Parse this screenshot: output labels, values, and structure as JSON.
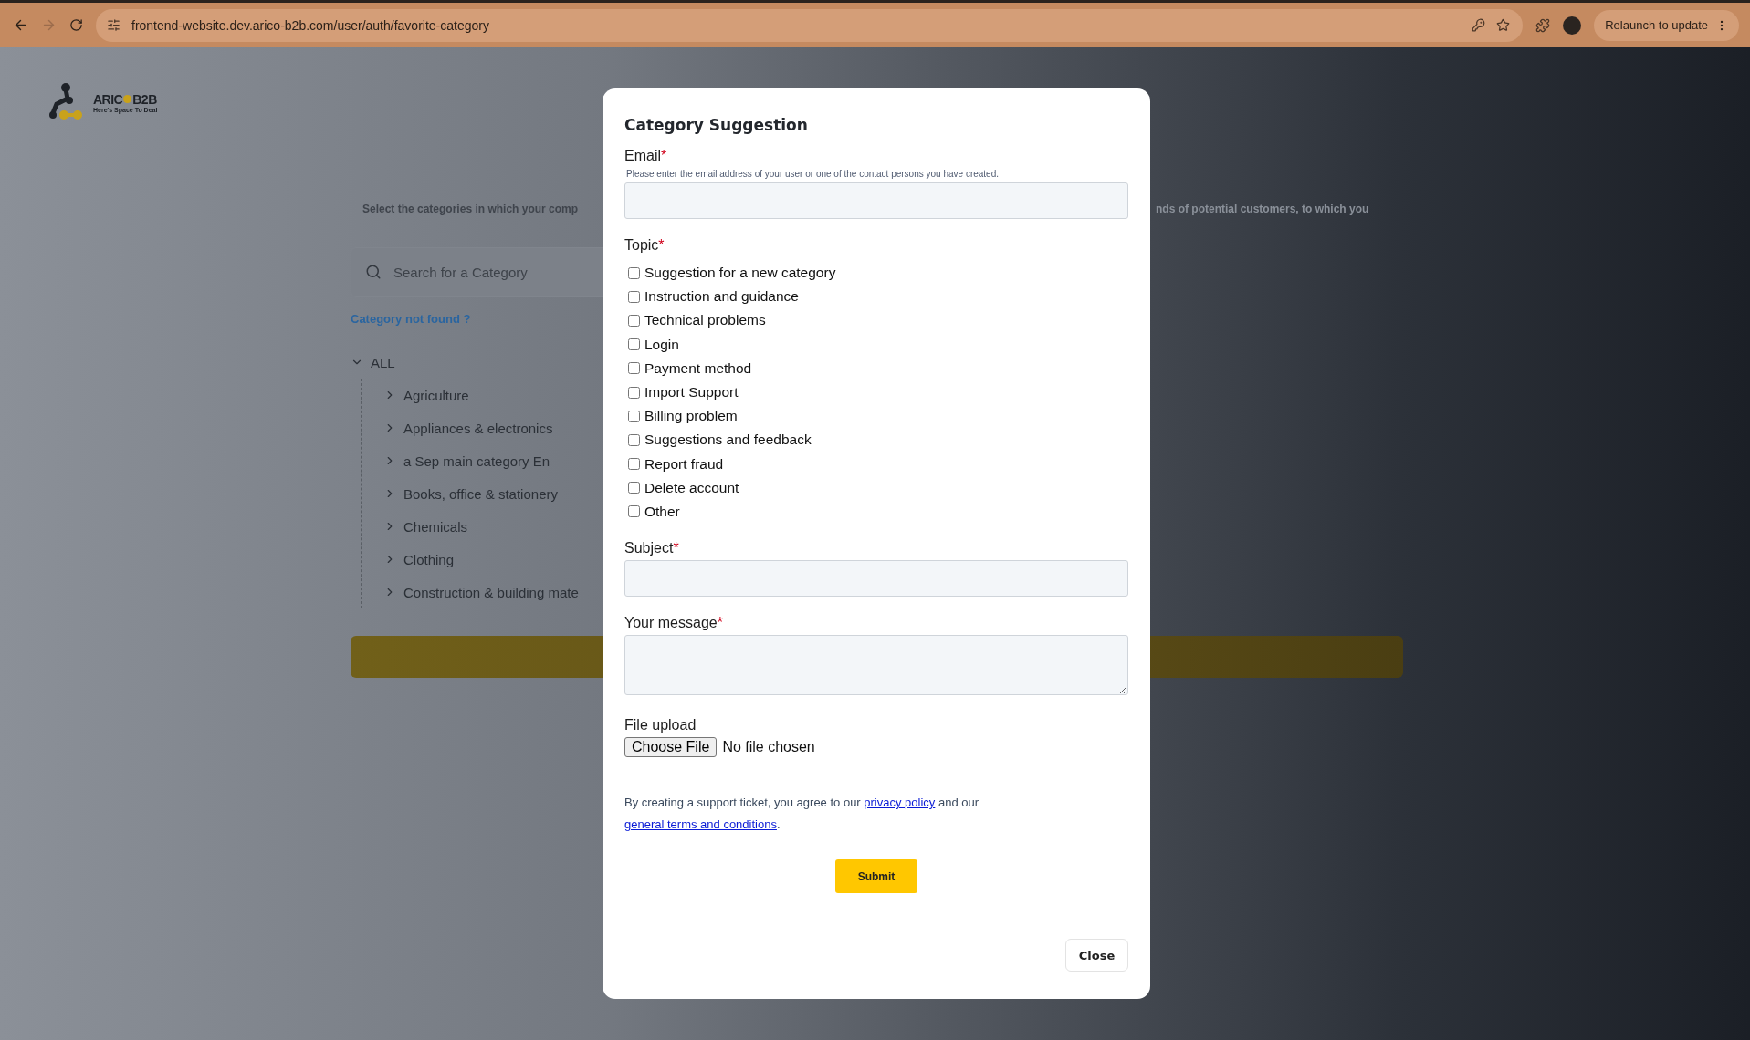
{
  "browser": {
    "nav": {
      "back_disabled": false,
      "forward_disabled": true
    },
    "url": "frontend-website.dev.arico-b2b.com/user/auth/favorite-category",
    "relaunch_label": "Relaunch to update"
  },
  "logo": {
    "name_start": "ARIC",
    "name_end": "B2B",
    "tagline": "Here's Space To Deal"
  },
  "page": {
    "intro_left": "Select the categories in which your comp",
    "intro_right": "nds of potential customers, to which you",
    "search": {
      "placeholder": "Search for a Category"
    },
    "not_found_link": "Category not found ?",
    "tree": {
      "label": "ALL",
      "expanded": true,
      "children": [
        {
          "label": "Agriculture",
          "expanded": false
        },
        {
          "label": "Appliances & electronics",
          "expanded": false
        },
        {
          "label": "a Sep main category En",
          "expanded": false
        },
        {
          "label": "Books, office & stationery",
          "expanded": false
        },
        {
          "label": "Chemicals",
          "expanded": false
        },
        {
          "label": "Clothing",
          "expanded": false
        },
        {
          "label": "Construction & building mate",
          "expanded": false
        }
      ]
    }
  },
  "modal": {
    "title": "Category Suggestion",
    "email": {
      "label": "Email",
      "required_mark": "*",
      "help": "Please enter the email address of your user or one of the contact persons you have created."
    },
    "topic": {
      "label": "Topic",
      "required_mark": "*",
      "options": [
        {
          "label": "Suggestion for a new category",
          "checked": false
        },
        {
          "label": "Instruction and guidance",
          "checked": false
        },
        {
          "label": "Technical problems",
          "checked": false
        },
        {
          "label": "Login",
          "checked": false
        },
        {
          "label": "Payment method",
          "checked": false
        },
        {
          "label": "Import Support",
          "checked": false
        },
        {
          "label": "Billing problem",
          "checked": false
        },
        {
          "label": "Suggestions and feedback",
          "checked": false
        },
        {
          "label": "Report fraud",
          "checked": false
        },
        {
          "label": "Delete account",
          "checked": false
        },
        {
          "label": "Other",
          "checked": false
        }
      ]
    },
    "subject": {
      "label": "Subject",
      "required_mark": "*"
    },
    "message": {
      "label": "Your message",
      "required_mark": "*"
    },
    "file_upload": {
      "label": "File upload",
      "button": "Choose File",
      "status": "No file chosen"
    },
    "legal": [
      {
        "kind": "text",
        "text": "By creating a support ticket, you agree to our "
      },
      {
        "kind": "link",
        "text": "privacy policy"
      },
      {
        "kind": "text",
        "text": " and our "
      },
      {
        "kind": "link",
        "text": "general terms and conditions"
      },
      {
        "kind": "text",
        "text": "."
      }
    ],
    "submit": "Submit",
    "close": "Close"
  }
}
